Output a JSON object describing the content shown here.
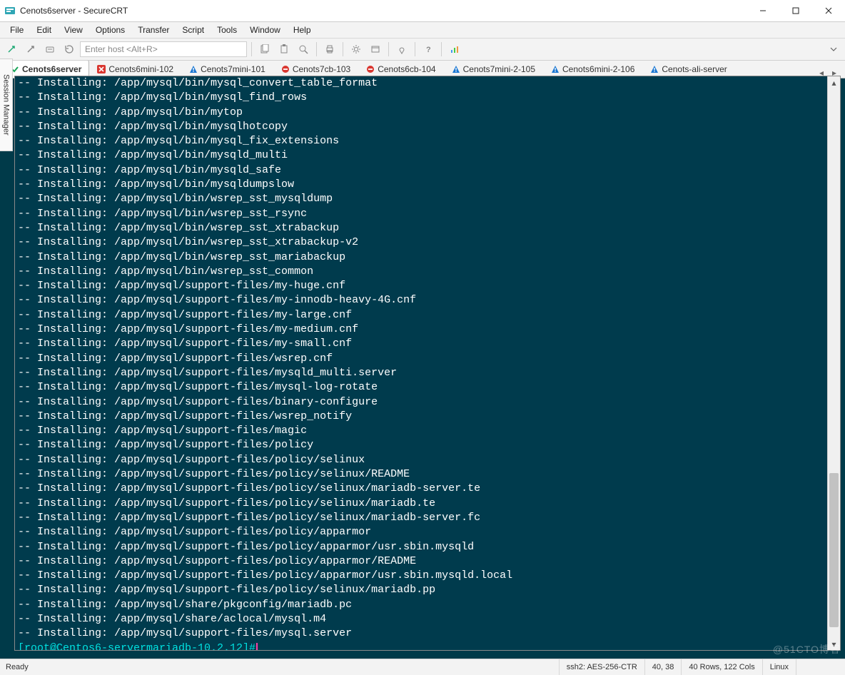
{
  "window": {
    "title": "Cenots6server - SecureCRT"
  },
  "menu": [
    "File",
    "Edit",
    "View",
    "Options",
    "Transfer",
    "Script",
    "Tools",
    "Window",
    "Help"
  ],
  "host_input": {
    "placeholder": "Enter host <Alt+R>"
  },
  "session_manager_label": "Session Manager",
  "tabs": [
    {
      "label": "Cenots6server",
      "state": "active",
      "icon": "check"
    },
    {
      "label": "Cenots6mini-102",
      "state": "error",
      "icon": "x"
    },
    {
      "label": "Cenots7mini-101",
      "state": "warn",
      "icon": "warn"
    },
    {
      "label": "Cenots7cb-103",
      "state": "stopped",
      "icon": "stop"
    },
    {
      "label": "Cenots6cb-104",
      "state": "stopped",
      "icon": "stop"
    },
    {
      "label": "Cenots7mini-2-105",
      "state": "warn",
      "icon": "warn"
    },
    {
      "label": "Cenots6mini-2-106",
      "state": "warn",
      "icon": "warn"
    },
    {
      "label": "Cenots-ali-server",
      "state": "warn",
      "icon": "warn"
    }
  ],
  "terminal": {
    "install_prefix": "-- Installing: ",
    "lines": [
      "/app/mysql/bin/mysql_convert_table_format",
      "/app/mysql/bin/mysql_find_rows",
      "/app/mysql/bin/mytop",
      "/app/mysql/bin/mysqlhotcopy",
      "/app/mysql/bin/mysql_fix_extensions",
      "/app/mysql/bin/mysqld_multi",
      "/app/mysql/bin/mysqld_safe",
      "/app/mysql/bin/mysqldumpslow",
      "/app/mysql/bin/wsrep_sst_mysqldump",
      "/app/mysql/bin/wsrep_sst_rsync",
      "/app/mysql/bin/wsrep_sst_xtrabackup",
      "/app/mysql/bin/wsrep_sst_xtrabackup-v2",
      "/app/mysql/bin/wsrep_sst_mariabackup",
      "/app/mysql/bin/wsrep_sst_common",
      "/app/mysql/support-files/my-huge.cnf",
      "/app/mysql/support-files/my-innodb-heavy-4G.cnf",
      "/app/mysql/support-files/my-large.cnf",
      "/app/mysql/support-files/my-medium.cnf",
      "/app/mysql/support-files/my-small.cnf",
      "/app/mysql/support-files/wsrep.cnf",
      "/app/mysql/support-files/mysqld_multi.server",
      "/app/mysql/support-files/mysql-log-rotate",
      "/app/mysql/support-files/binary-configure",
      "/app/mysql/support-files/wsrep_notify",
      "/app/mysql/support-files/magic",
      "/app/mysql/support-files/policy",
      "/app/mysql/support-files/policy/selinux",
      "/app/mysql/support-files/policy/selinux/README",
      "/app/mysql/support-files/policy/selinux/mariadb-server.te",
      "/app/mysql/support-files/policy/selinux/mariadb.te",
      "/app/mysql/support-files/policy/selinux/mariadb-server.fc",
      "/app/mysql/support-files/policy/apparmor",
      "/app/mysql/support-files/policy/apparmor/usr.sbin.mysqld",
      "/app/mysql/support-files/policy/apparmor/README",
      "/app/mysql/support-files/policy/apparmor/usr.sbin.mysqld.local",
      "/app/mysql/support-files/policy/selinux/mariadb.pp",
      "/app/mysql/share/pkgconfig/mariadb.pc",
      "/app/mysql/share/aclocal/mysql.m4",
      "/app/mysql/support-files/mysql.server"
    ],
    "prompt": "[root@Centos6-servermariadb-10.2.12]#"
  },
  "status": {
    "ready": "Ready",
    "conn": "ssh2: AES-256-CTR",
    "cursor": "40,  38",
    "size": "40 Rows, 122 Cols",
    "vt": "Linux"
  },
  "watermark": "@51CTO博客"
}
